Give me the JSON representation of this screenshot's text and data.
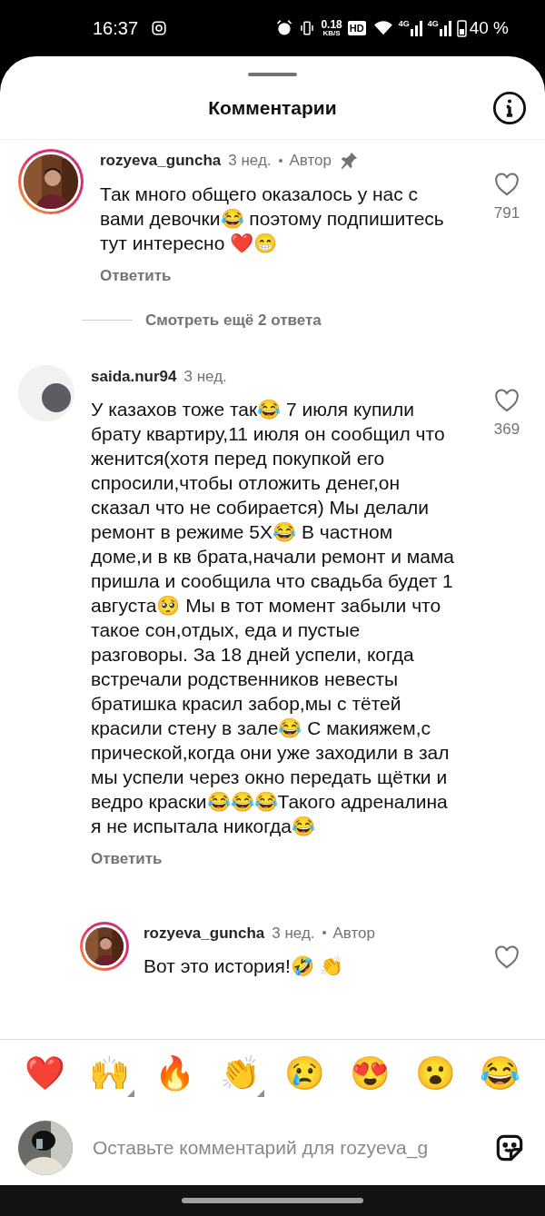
{
  "status_bar": {
    "time": "16:37",
    "speed": "0.18",
    "speed_unit": "KB/S",
    "hd": "HD",
    "network_1": "4G",
    "network_2": "4G",
    "battery": "40 %"
  },
  "sheet": {
    "title": "Комментарии"
  },
  "comments": [
    {
      "username": "rozyeva_guncha",
      "time": "3 нед.",
      "author": "Автор",
      "pinned": true,
      "text": "Так много общего оказалось у нас с вами девочки😂 поэтому подпишитесь тут интересно ❤️😁",
      "likes": "791",
      "reply": "Ответить",
      "more_replies": "Смотреть ещё 2 ответа",
      "is_reply": false,
      "story_ring": true
    },
    {
      "username": "saida.nur94",
      "time": "3 нед.",
      "text": "У казахов тоже так😂 7 июля купили брату квартиру,11 июля он сообщил что женится(хотя перед покупкой его спросили,чтобы отложить денег,он сказал что не собирается) Мы делали ремонт в режиме 5Х😂 В частном доме,и в кв брата,начали ремонт и мама пришла и сообщила что свадьба будет 1 августа🥺 Мы в тот момент забыли что такое сон,отдых, еда и пустые разговоры. За 18 дней успели, когда встречали родственников невесты братишка красил забор,мы с тётей красили стену в зале😂 С макияжем,с прической,когда они уже заходили в зал мы успели через окно передать щётки и ведро краски😂😂😂Такого адреналина я не испытала никогда😂",
      "likes": "369",
      "reply": "Ответить",
      "is_reply": false,
      "pinned": false,
      "story_ring": false
    },
    {
      "username": "rozyeva_guncha",
      "time": "3 нед.",
      "author": "Автор",
      "text": "Вот это история!🤣 👏",
      "is_reply": true,
      "pinned": false,
      "story_ring": true
    }
  ],
  "reactions": [
    {
      "emoji": "❤️",
      "has_options": false
    },
    {
      "emoji": "🙌",
      "has_options": true
    },
    {
      "emoji": "🔥",
      "has_options": false
    },
    {
      "emoji": "👏",
      "has_options": true
    },
    {
      "emoji": "😢",
      "has_options": false
    },
    {
      "emoji": "😍",
      "has_options": false
    },
    {
      "emoji": "😮",
      "has_options": false
    },
    {
      "emoji": "😂",
      "has_options": false
    }
  ],
  "composer": {
    "placeholder": "Оставьте комментарий для rozyeva_g"
  }
}
